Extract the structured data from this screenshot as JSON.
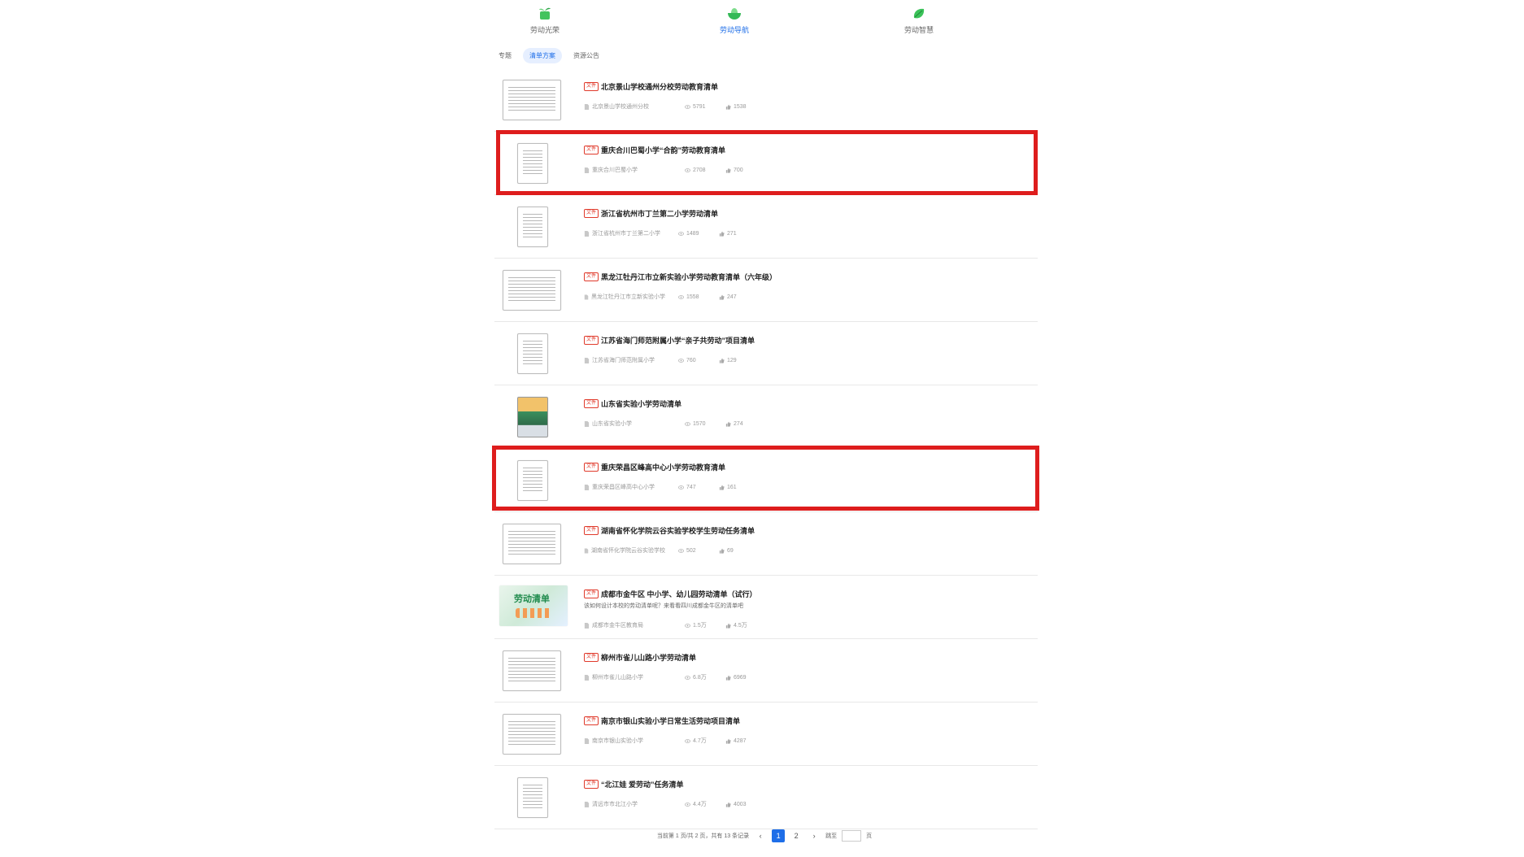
{
  "topnav": [
    {
      "label": "劳动光荣",
      "icon": "green-sprout-icon",
      "active": false
    },
    {
      "label": "劳动导航",
      "icon": "green-bowl-icon",
      "active": true
    },
    {
      "label": "劳动智慧",
      "icon": "green-leaf-icon",
      "active": false
    }
  ],
  "tabs": [
    {
      "label": "专题",
      "active": false
    },
    {
      "label": "清单方案",
      "active": true
    },
    {
      "label": "资源公告",
      "active": false
    }
  ],
  "items": [
    {
      "tag": "文件",
      "title": "北京景山学校通州分校劳动教育清单",
      "source": "北京景山学校通州分校",
      "views": "5791",
      "likes": "1538",
      "thumb": "landscape",
      "desc": ""
    },
    {
      "tag": "文件",
      "title": "重庆合川巴蜀小学“合韵”劳动教育清单",
      "source": "重庆合川巴蜀小学",
      "views": "2708",
      "likes": "700",
      "thumb": "portrait",
      "desc": ""
    },
    {
      "tag": "文件",
      "title": "浙江省杭州市丁兰第二小学劳动清单",
      "source": "浙江省杭州市丁兰第二小学",
      "views": "1489",
      "likes": "271",
      "thumb": "portrait",
      "desc": ""
    },
    {
      "tag": "文件",
      "title": "黑龙江牡丹江市立新实验小学劳动教育清单（六年级）",
      "source": "黑龙江牡丹江市立新实验小学",
      "views": "1558",
      "likes": "247",
      "thumb": "landscape",
      "desc": ""
    },
    {
      "tag": "文件",
      "title": "江苏省海门师范附属小学“亲子共劳动”项目清单",
      "source": "江苏省海门师范附属小学",
      "views": "760",
      "likes": "129",
      "thumb": "portrait",
      "desc": ""
    },
    {
      "tag": "文件",
      "title": "山东省实验小学劳动清单",
      "source": "山东省实验小学",
      "views": "1570",
      "likes": "274",
      "thumb": "cover",
      "desc": ""
    },
    {
      "tag": "文件",
      "title": "重庆荣昌区峰高中心小学劳动教育清单",
      "source": "重庆荣昌区峰高中心小学",
      "views": "747",
      "likes": "161",
      "thumb": "portrait",
      "desc": ""
    },
    {
      "tag": "文件",
      "title": "湖南省怀化学院云谷实验学校学生劳动任务清单",
      "source": "湖南省怀化学院云谷实验学校",
      "views": "502",
      "likes": "69",
      "thumb": "landscape",
      "desc": ""
    },
    {
      "tag": "文件",
      "title": "成都市金牛区 中小学、幼儿园劳动清单（试行）",
      "source": "成都市金牛区教育局",
      "views": "1.5万",
      "likes": "4.5万",
      "thumb": "banner",
      "desc": "该如何设计本校的劳动清单呢？来看看四川成都金牛区的清单吧",
      "banner_text": "劳动清单"
    },
    {
      "tag": "文件",
      "title": "柳州市雀儿山路小学劳动清单",
      "source": "柳州市雀儿山路小学",
      "views": "6.8万",
      "likes": "6969",
      "thumb": "landscape",
      "desc": ""
    },
    {
      "tag": "文件",
      "title": "南京市银山实验小学日常生活劳动项目清单",
      "source": "南京市银山实验小学",
      "views": "4.7万",
      "likes": "4287",
      "thumb": "landscape",
      "desc": ""
    },
    {
      "tag": "文件",
      "title": "“北江娃 爱劳动”任务清单",
      "source": "清远市市北江小学",
      "views": "4.4万",
      "likes": "4003",
      "thumb": "portrait",
      "desc": ""
    }
  ],
  "pagination": {
    "summary": "当前第 1 页/共 2 页，共有 13 条记录",
    "prev": "‹",
    "pages": [
      "1",
      "2"
    ],
    "next": "›",
    "goto_label": "跳至",
    "goto_suffix": "页",
    "goto_value": ""
  },
  "colors": {
    "accent": "#1e6ee8",
    "tag_red": "#e03a2b",
    "highlight": "#de1d1d",
    "icon_green": "#3cc35a"
  }
}
